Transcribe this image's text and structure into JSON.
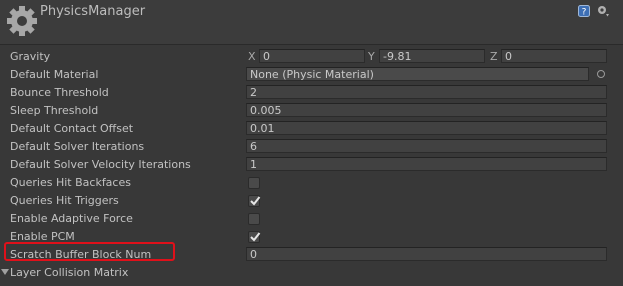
{
  "header": {
    "title": "PhysicsManager"
  },
  "gravity": {
    "label": "Gravity",
    "x_label": "X",
    "x_value": "0",
    "y_label": "Y",
    "y_value": "-9.81",
    "z_label": "Z",
    "z_value": "0"
  },
  "default_material": {
    "label": "Default Material",
    "value": "None (Physic Material)"
  },
  "bounce_threshold": {
    "label": "Bounce Threshold",
    "value": "2"
  },
  "sleep_threshold": {
    "label": "Sleep Threshold",
    "value": "0.005"
  },
  "default_contact_offset": {
    "label": "Default Contact Offset",
    "value": "0.01"
  },
  "default_solver_iterations": {
    "label": "Default Solver Iterations",
    "value": "6"
  },
  "default_solver_velocity_iterations": {
    "label": "Default Solver Velocity Iterations",
    "value": "1"
  },
  "queries_hit_backfaces": {
    "label": "Queries Hit Backfaces",
    "checked": false
  },
  "queries_hit_triggers": {
    "label": "Queries Hit Triggers",
    "checked": true
  },
  "enable_adaptive_force": {
    "label": "Enable Adaptive Force",
    "checked": false
  },
  "enable_pcm": {
    "label": "Enable PCM",
    "checked": true
  },
  "scratch_buffer_block_num": {
    "label": "Scratch Buffer Block Num",
    "value": "0"
  },
  "layer_collision_matrix": {
    "label": "Layer Collision Matrix"
  },
  "colors": {
    "background": "#383838",
    "field": "#414141",
    "highlight": "#e0101a"
  },
  "icons": {
    "header": "gear-icon",
    "help": "help-icon",
    "settings": "gear-icon",
    "object_picker": "object-picker-icon",
    "checkmark": "checkmark-icon",
    "foldout": "foldout-arrow-icon"
  }
}
